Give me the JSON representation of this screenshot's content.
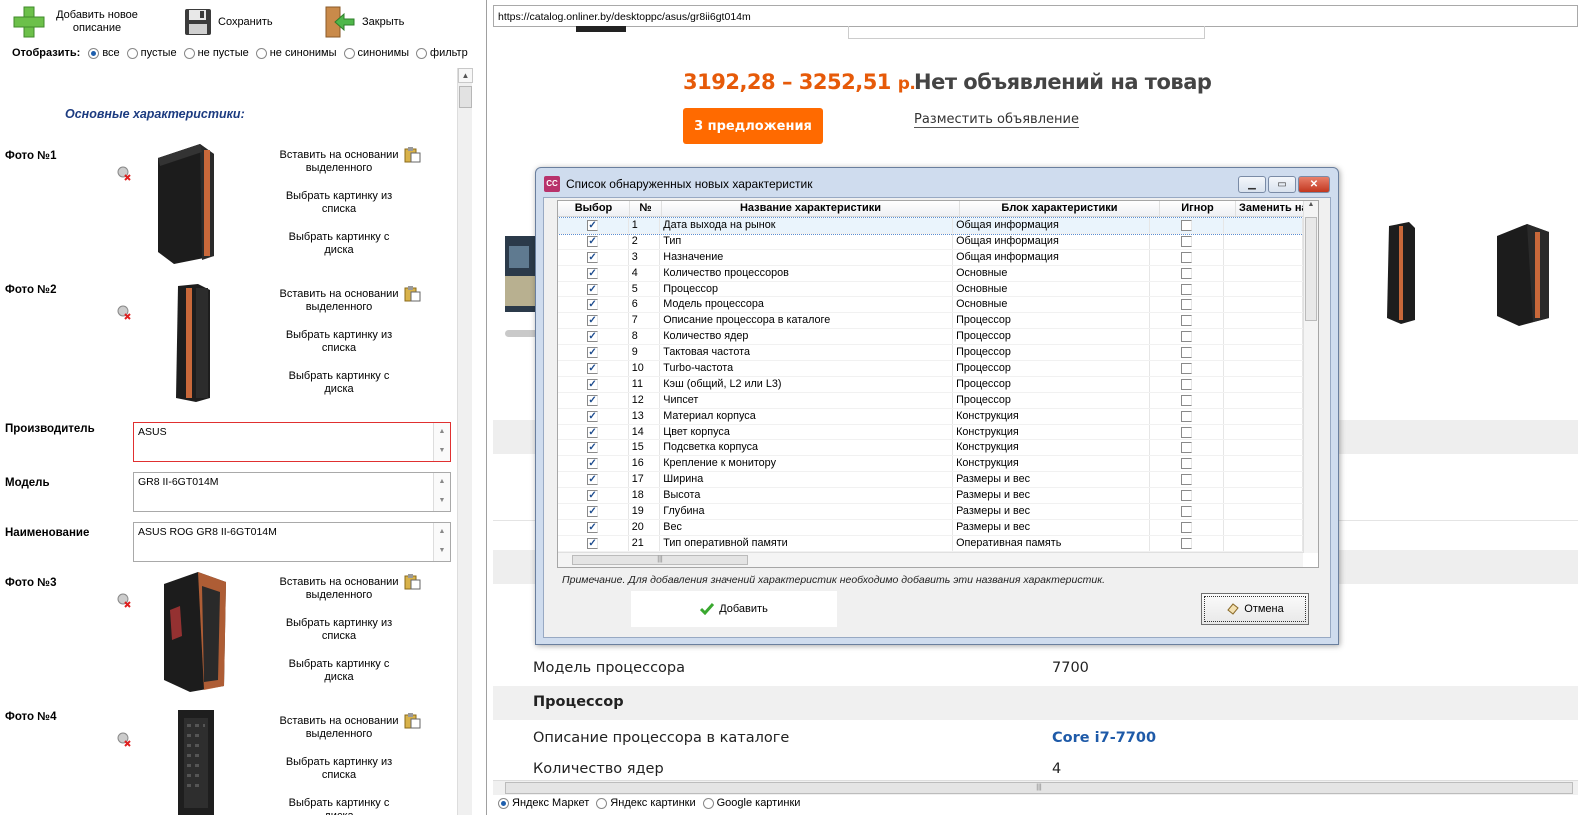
{
  "toolbar": {
    "add_label": "Добавить новое описание",
    "save_label": "Сохранить",
    "close_label": "Закрыть"
  },
  "filter": {
    "label": "Отобразить:",
    "options": [
      "все",
      "пустые",
      "не пустые",
      "не синонимы",
      "синонимы",
      "фильтр"
    ],
    "selected": "все"
  },
  "section_title": "Основные характеристики:",
  "photo_actions": {
    "paste": "Вставить на основании выделенного",
    "pick_list": "Выбрать картинку из списка",
    "pick_disk": "Выбрать картинку с диска"
  },
  "photos": [
    {
      "label": "Фото №1"
    },
    {
      "label": "Фото №2"
    },
    {
      "label": "Фото №3"
    },
    {
      "label": "Фото №4"
    }
  ],
  "fields": {
    "manufacturer": {
      "label": "Производитель",
      "value": "ASUS"
    },
    "model": {
      "label": "Модель",
      "value": "GR8 II-6GT014M"
    },
    "name": {
      "label": "Наименование",
      "value": "ASUS ROG GR8 II-6GT014M"
    }
  },
  "browser": {
    "url": "https://catalog.onliner.by/desktoppc/asus/gr8ii6gt014m",
    "price": "3192,28 – 3252,51",
    "price_unit": "р.",
    "no_ads": "Нет объявлений на товар",
    "offers_button": "3 предложения",
    "post_ad": "Разместить объявление",
    "spec_rows": [
      {
        "key": "Модель процессора",
        "value": "7700"
      },
      {
        "key": "Процессор",
        "value": ""
      },
      {
        "key": "Описание процессора в каталоге",
        "value": "Core i7-7700"
      },
      {
        "key": "Количество ядер",
        "value": "4"
      }
    ],
    "bottom_radios": [
      "Яндекс Маркет",
      "Яндекс картинки",
      "Google картинки"
    ],
    "bottom_selected": "Яндекс Маркет"
  },
  "dialog": {
    "title": "Список обнаруженных новых характеристик",
    "app_icon_text": "CC",
    "columns": [
      "Выбор",
      "№",
      "Название характеристики",
      "Блок характеристики",
      "Игнор",
      "Заменить на"
    ],
    "rows": [
      {
        "num": "1",
        "name": "Дата выхода на рынок",
        "block": "Общая информация",
        "checked": true,
        "ignore": false
      },
      {
        "num": "2",
        "name": "Тип",
        "block": "Общая информация",
        "checked": true,
        "ignore": false
      },
      {
        "num": "3",
        "name": "Назначение",
        "block": "Общая информация",
        "checked": true,
        "ignore": false
      },
      {
        "num": "4",
        "name": "Количество процессоров",
        "block": "Основные",
        "checked": true,
        "ignore": false
      },
      {
        "num": "5",
        "name": "Процессор",
        "block": "Основные",
        "checked": true,
        "ignore": false
      },
      {
        "num": "6",
        "name": "Модель процессора",
        "block": "Основные",
        "checked": true,
        "ignore": false
      },
      {
        "num": "7",
        "name": "Описание процессора в каталоге",
        "block": "Процессор",
        "checked": true,
        "ignore": false
      },
      {
        "num": "8",
        "name": "Количество ядер",
        "block": "Процессор",
        "checked": true,
        "ignore": false
      },
      {
        "num": "9",
        "name": "Тактовая частота",
        "block": "Процессор",
        "checked": true,
        "ignore": false
      },
      {
        "num": "10",
        "name": "Turbo-частота",
        "block": "Процессор",
        "checked": true,
        "ignore": false
      },
      {
        "num": "11",
        "name": "Кэш (общий, L2 или L3)",
        "block": "Процессор",
        "checked": true,
        "ignore": false
      },
      {
        "num": "12",
        "name": "Чипсет",
        "block": "Процессор",
        "checked": true,
        "ignore": false
      },
      {
        "num": "13",
        "name": "Материал корпуса",
        "block": "Конструкция",
        "checked": true,
        "ignore": false
      },
      {
        "num": "14",
        "name": "Цвет корпуса",
        "block": "Конструкция",
        "checked": true,
        "ignore": false
      },
      {
        "num": "15",
        "name": "Подсветка корпуса",
        "block": "Конструкция",
        "checked": true,
        "ignore": false
      },
      {
        "num": "16",
        "name": "Крепление к монитору",
        "block": "Конструкция",
        "checked": true,
        "ignore": false
      },
      {
        "num": "17",
        "name": "Ширина",
        "block": "Размеры и вес",
        "checked": true,
        "ignore": false
      },
      {
        "num": "18",
        "name": "Высота",
        "block": "Размеры и вес",
        "checked": true,
        "ignore": false
      },
      {
        "num": "19",
        "name": "Глубина",
        "block": "Размеры и вес",
        "checked": true,
        "ignore": false
      },
      {
        "num": "20",
        "name": "Вес",
        "block": "Размеры и вес",
        "checked": true,
        "ignore": false
      },
      {
        "num": "21",
        "name": "Тип оперативной памяти",
        "block": "Оперативная память",
        "checked": true,
        "ignore": false
      }
    ],
    "note": "Примечание. Для добавления значений характеристик необходимо добавить эти названия характеристик.",
    "add_button": "Добавить",
    "cancel_button": "Отмена"
  },
  "colors": {
    "price": "#e65a09",
    "offers_button": "#ff6a00",
    "section_title": "#1c3b80",
    "link": "#1e5aa8"
  }
}
